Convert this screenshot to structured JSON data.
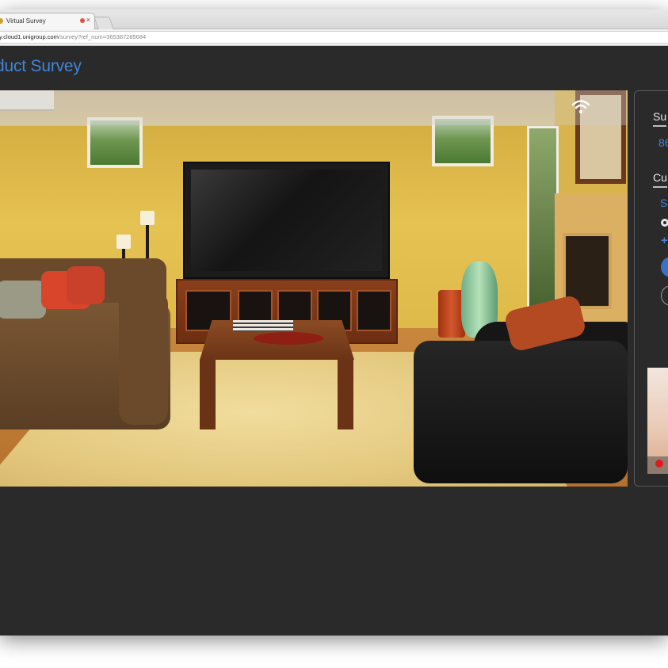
{
  "browser": {
    "tab_title": "Virtual Survey",
    "tab_close_glyph": "×",
    "url_host": "y.cloud1.unigroup.com",
    "url_path": "/survey?ref_num=365387285684"
  },
  "page": {
    "title": "duct Survey"
  },
  "video": {
    "status_icon": "wifi-icon"
  },
  "side_panel": {
    "heading_1": "Su",
    "value_1": "86",
    "heading_2": "Cu",
    "link_1": "S",
    "plus_label": "+"
  },
  "colors": {
    "accent": "#3f86d8",
    "background": "#2a2a2a",
    "record": "#e01b1b"
  }
}
